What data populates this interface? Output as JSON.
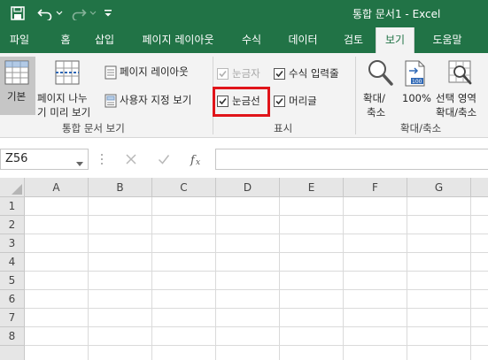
{
  "app": {
    "title": "통합 문서1  -  Excel",
    "accent": "#217346",
    "highlight_color": "#e0141a"
  },
  "quick_access": {
    "save_icon": "save-icon",
    "undo_icon": "undo-icon",
    "redo_icon": "redo-icon",
    "customize_icon": "customize-qat-icon"
  },
  "tabs": [
    {
      "label": "파일"
    },
    {
      "label": "홈"
    },
    {
      "label": "삽입"
    },
    {
      "label": "페이지 레이아웃"
    },
    {
      "label": "수식"
    },
    {
      "label": "데이터"
    },
    {
      "label": "검토"
    },
    {
      "label": "보기",
      "active": true
    },
    {
      "label": "도움말"
    }
  ],
  "ribbon": {
    "workbook_views": {
      "normal_label": "기본",
      "page_break_line1": "페이지 나누",
      "page_break_line2": "기 미리 보기",
      "page_layout_label": "페이지 레이아웃",
      "custom_views_label": "사용자 지정 보기",
      "group_label": "통합 문서 보기"
    },
    "show": {
      "ruler_label": "눈금자",
      "ruler_checked": true,
      "ruler_disabled": true,
      "gridlines_label": "눈금선",
      "gridlines_checked": true,
      "formula_bar_label": "수식 입력줄",
      "formula_bar_checked": true,
      "headings_label": "머리글",
      "headings_checked": true,
      "group_label": "표시"
    },
    "zoom": {
      "zoom_line1": "확대/",
      "zoom_line2": "축소",
      "hundred_label": "100%",
      "selection_line1": "선택 영역",
      "selection_line2": "확대/축소",
      "group_label": "확대/축소"
    }
  },
  "formula_bar": {
    "name_box_value": "Z56",
    "formula_value": ""
  },
  "grid": {
    "columns": [
      "A",
      "B",
      "C",
      "D",
      "E",
      "F",
      "G"
    ],
    "rows": [
      "1",
      "2",
      "3",
      "4",
      "5",
      "6",
      "7",
      "8"
    ]
  }
}
